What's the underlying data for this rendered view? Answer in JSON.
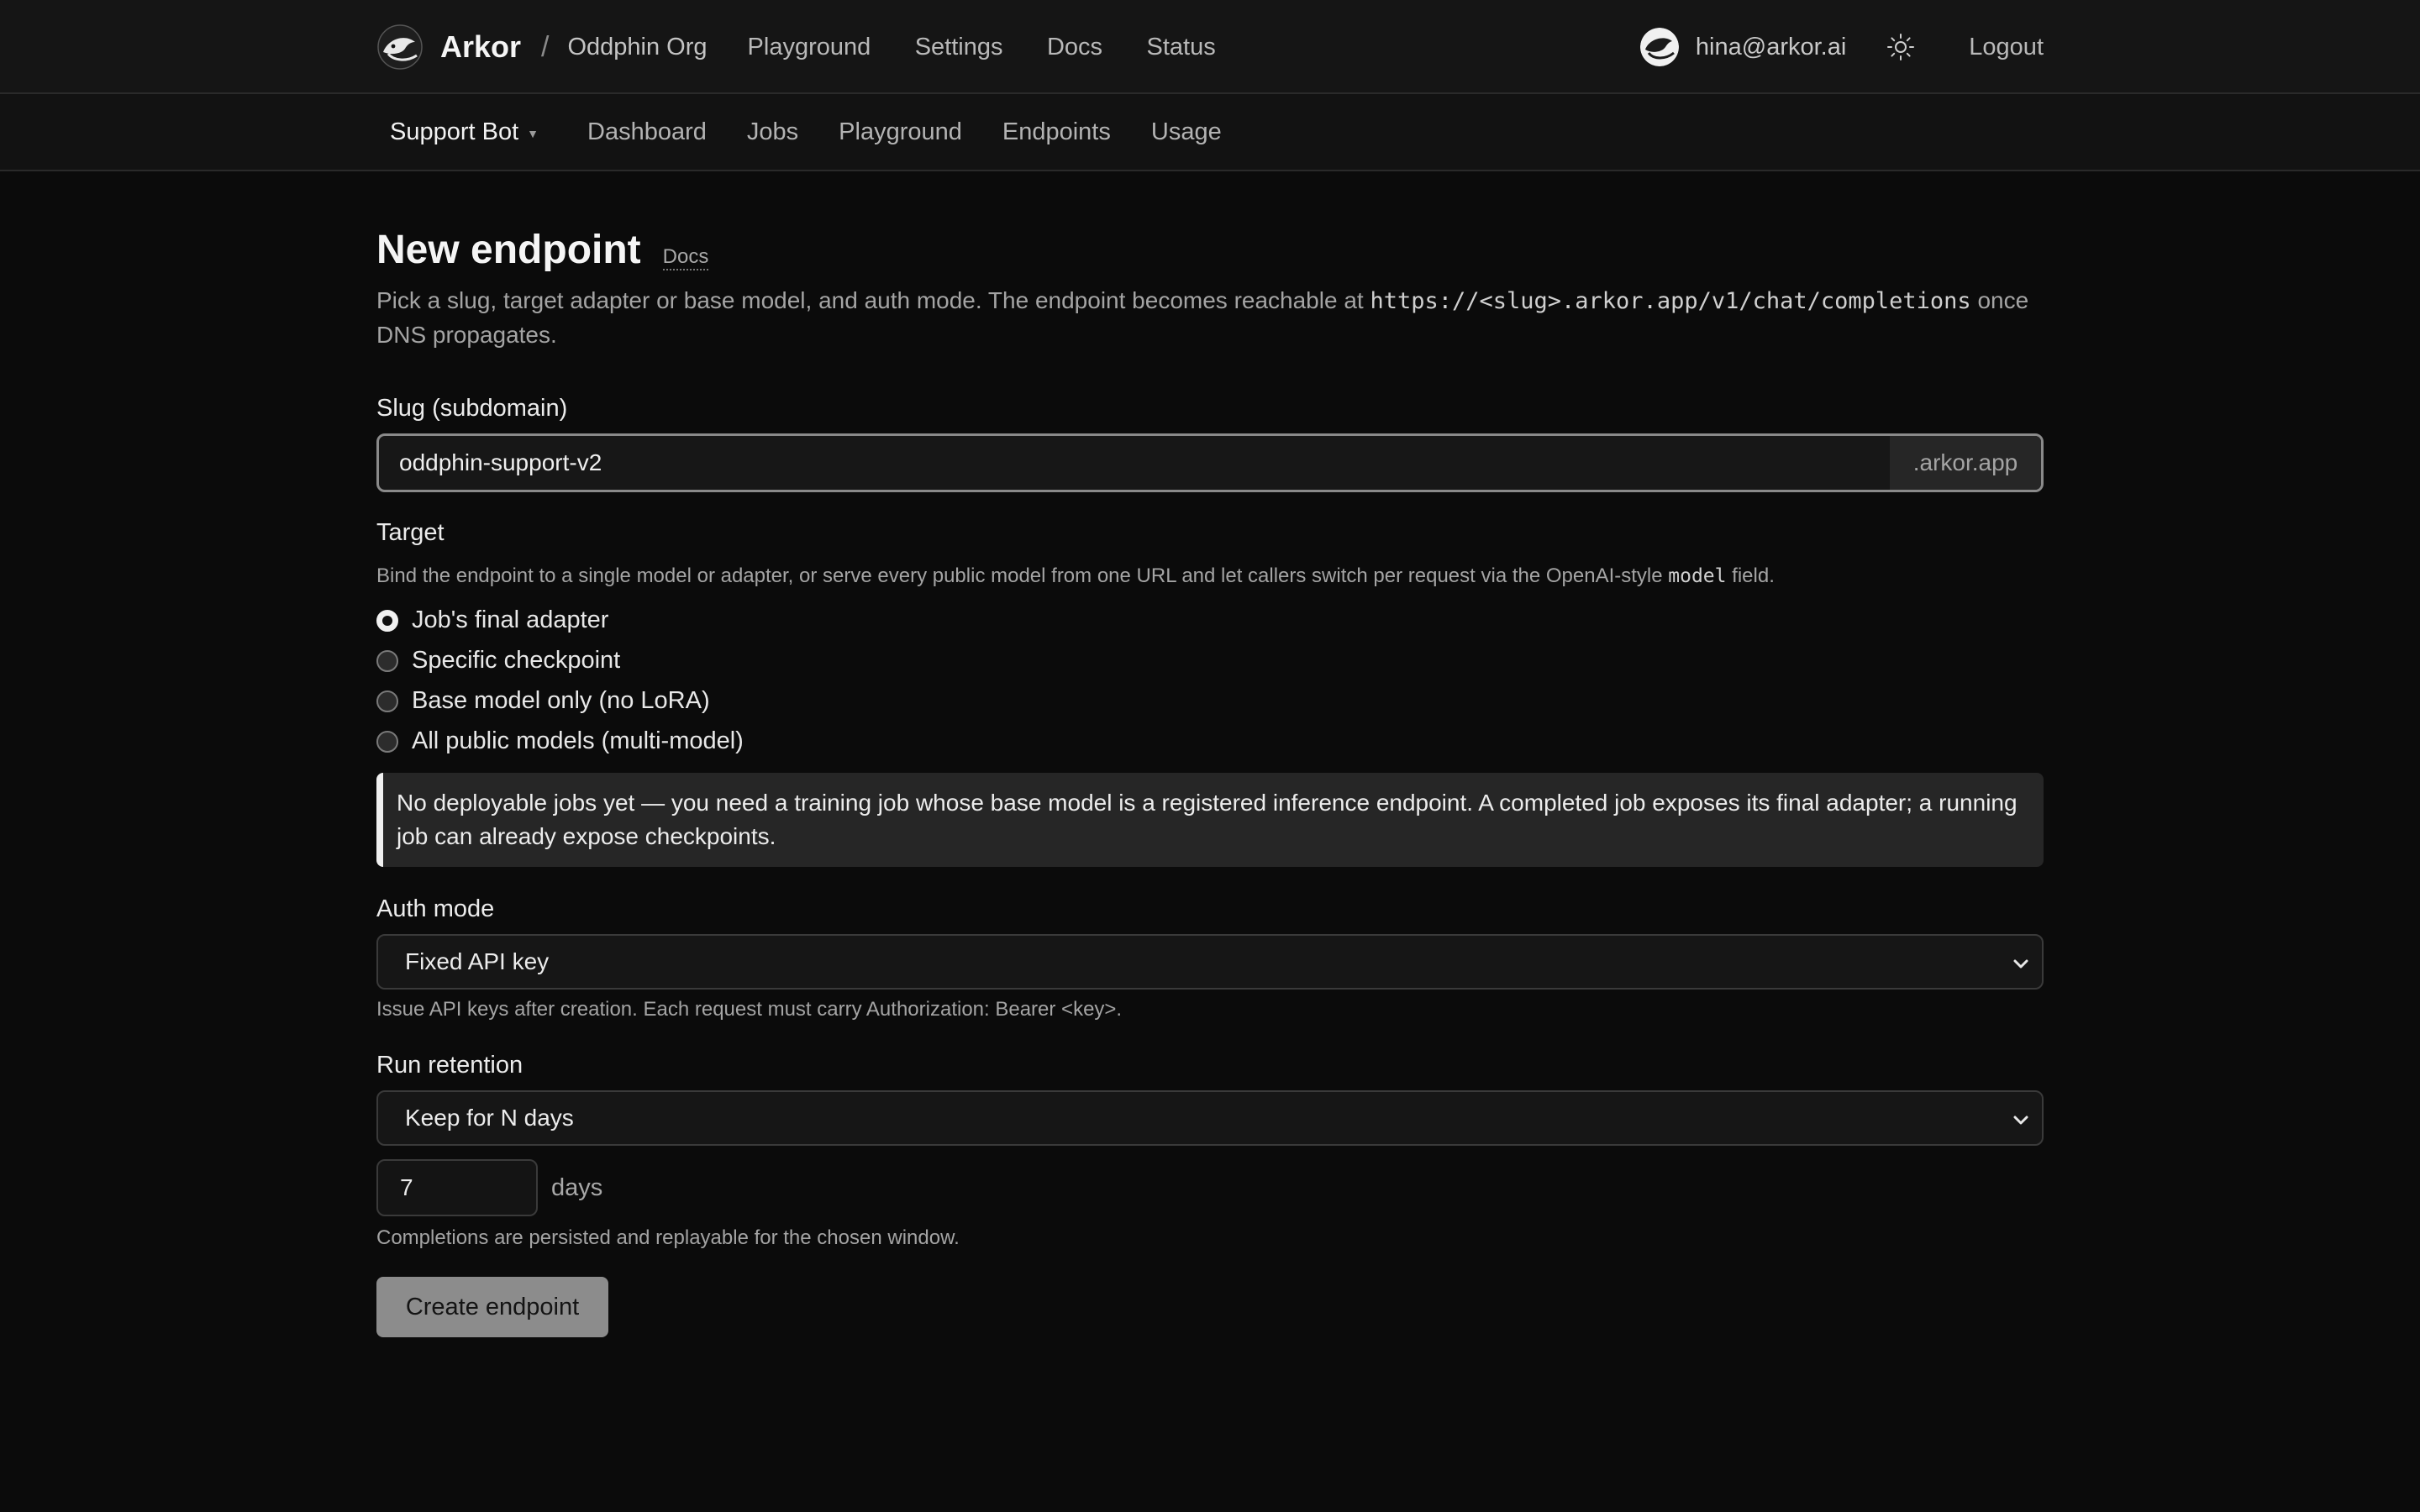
{
  "header": {
    "brand": "Arkor",
    "separator": "/",
    "org": "Oddphin Org",
    "nav": [
      "Playground",
      "Settings",
      "Docs",
      "Status"
    ],
    "user_email": "hina@arkor.ai",
    "logout_label": "Logout",
    "icons": {
      "logo": "dolphin-logo-icon",
      "avatar": "user-avatar",
      "theme": "sun-icon"
    }
  },
  "subnav": {
    "project": "Support Bot",
    "items": [
      "Dashboard",
      "Jobs",
      "Playground",
      "Endpoints",
      "Usage"
    ]
  },
  "page": {
    "title": "New endpoint",
    "docs_label": "Docs",
    "intro_before": "Pick a slug, target adapter or base model, and auth mode. The endpoint becomes reachable at ",
    "intro_url": "https://<slug>.arkor.app/v1/chat/completions",
    "intro_after": " once DNS propagates."
  },
  "slug": {
    "label": "Slug (subdomain)",
    "value": "oddphin-support-v2",
    "suffix": ".arkor.app"
  },
  "target": {
    "label": "Target",
    "help_before": "Bind the endpoint to a single model or adapter, or serve every public model from one URL and let callers switch per request via the OpenAI-style ",
    "help_code": "model",
    "help_after": " field.",
    "options": [
      {
        "label": "Job's final adapter",
        "checked": true
      },
      {
        "label": "Specific checkpoint",
        "checked": false
      },
      {
        "label": "Base model only (no LoRA)",
        "checked": false
      },
      {
        "label": "All public models (multi-model)",
        "checked": false
      }
    ],
    "notice": "No deployable jobs yet — you need a training job whose base model is a registered inference endpoint. A completed job exposes its final adapter; a running job can already expose checkpoints."
  },
  "auth": {
    "label": "Auth mode",
    "selected": "Fixed API key",
    "help": "Issue API keys after creation. Each request must carry Authorization: Bearer <key>."
  },
  "retention": {
    "label": "Run retention",
    "selected": "Keep for N days",
    "days_value": "7",
    "days_unit": "days",
    "help": "Completions are persisted and replayable for the chosen window."
  },
  "submit_label": "Create endpoint",
  "colors": {
    "background": "#0b0b0b",
    "topbar": "#151515",
    "accent_button": "#8c8c8c",
    "notice_bg": "#262626"
  }
}
